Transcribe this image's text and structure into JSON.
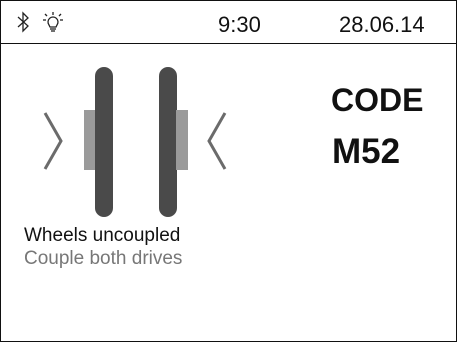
{
  "status_bar": {
    "bluetooth_icon": "bluetooth-icon",
    "light_icon": "light-bulb-icon",
    "time": "9:30",
    "date": "28.06.14"
  },
  "error": {
    "code_label": "CODE",
    "code_value": "M52",
    "message": "Wheels uncoupled",
    "hint": "Couple both drives"
  },
  "colors": {
    "wheel": "#4a4a4a",
    "hub": "#9a9a9a",
    "arrow": "#6b6b6b",
    "hint_text": "#777777"
  }
}
